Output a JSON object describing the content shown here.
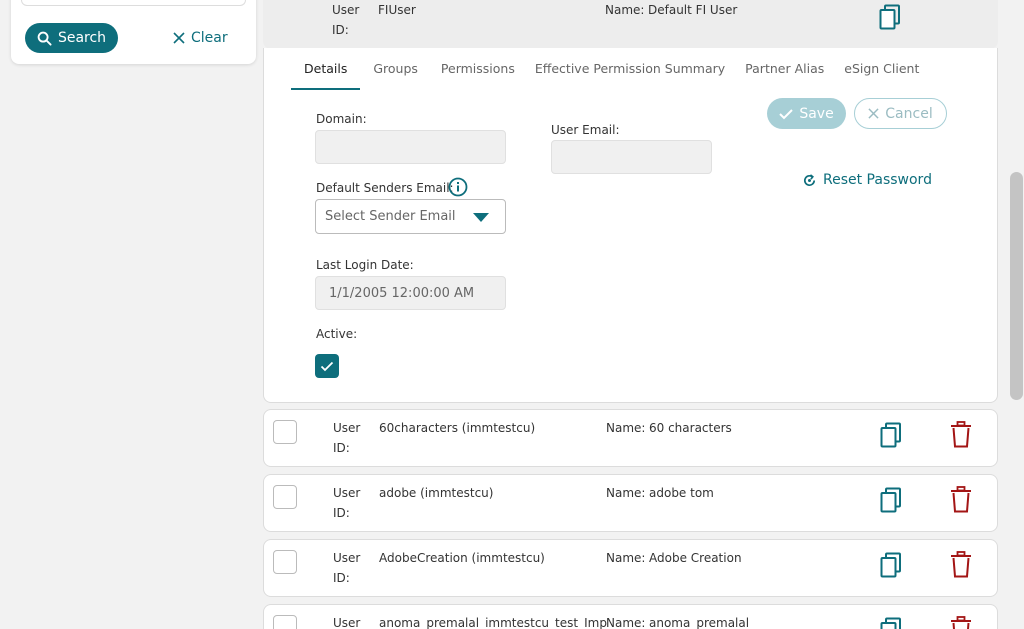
{
  "left_panel": {
    "search_label": "Search",
    "clear_label": "Clear"
  },
  "expanded_user": {
    "user_id_label_1": "User",
    "user_id_label_2": "ID:",
    "user_id": "FIUser",
    "name_label": "Name:",
    "name": "Default FI User"
  },
  "tabs": [
    {
      "label": "Details"
    },
    {
      "label": "Groups"
    },
    {
      "label": "Permissions"
    },
    {
      "label": "Effective Permission Summary"
    },
    {
      "label": "Partner Alias"
    },
    {
      "label": "eSign Client"
    }
  ],
  "details": {
    "domain_label": "Domain:",
    "domain_value": "",
    "user_email_label": "User Email:",
    "user_email_value": "",
    "default_senders_label": "Default Senders Email:",
    "sender_placeholder": "Select Sender Email",
    "last_login_label": "Last Login Date:",
    "last_login_value": "1/1/2005 12:00:00 AM",
    "active_label": "Active:",
    "active_checked": true,
    "save_label": "Save",
    "cancel_label": "Cancel",
    "reset_password_label": "Reset Password"
  },
  "user_rows": [
    {
      "user_id": "60characters (immtestcu)",
      "name": "60 characters"
    },
    {
      "user_id": "adobe (immtestcu)",
      "name": "adobe tom"
    },
    {
      "user_id": "AdobeCreation (immtestcu)",
      "name": "Adobe Creation"
    },
    {
      "user_id": "anoma_premalal_immtestcu_test_Imp",
      "name": "anoma_premalal"
    }
  ],
  "row_labels": {
    "user": "User",
    "id": "ID:",
    "name": "Name:"
  },
  "colors": {
    "accent": "#0e6e7c",
    "delete": "#a31515"
  }
}
